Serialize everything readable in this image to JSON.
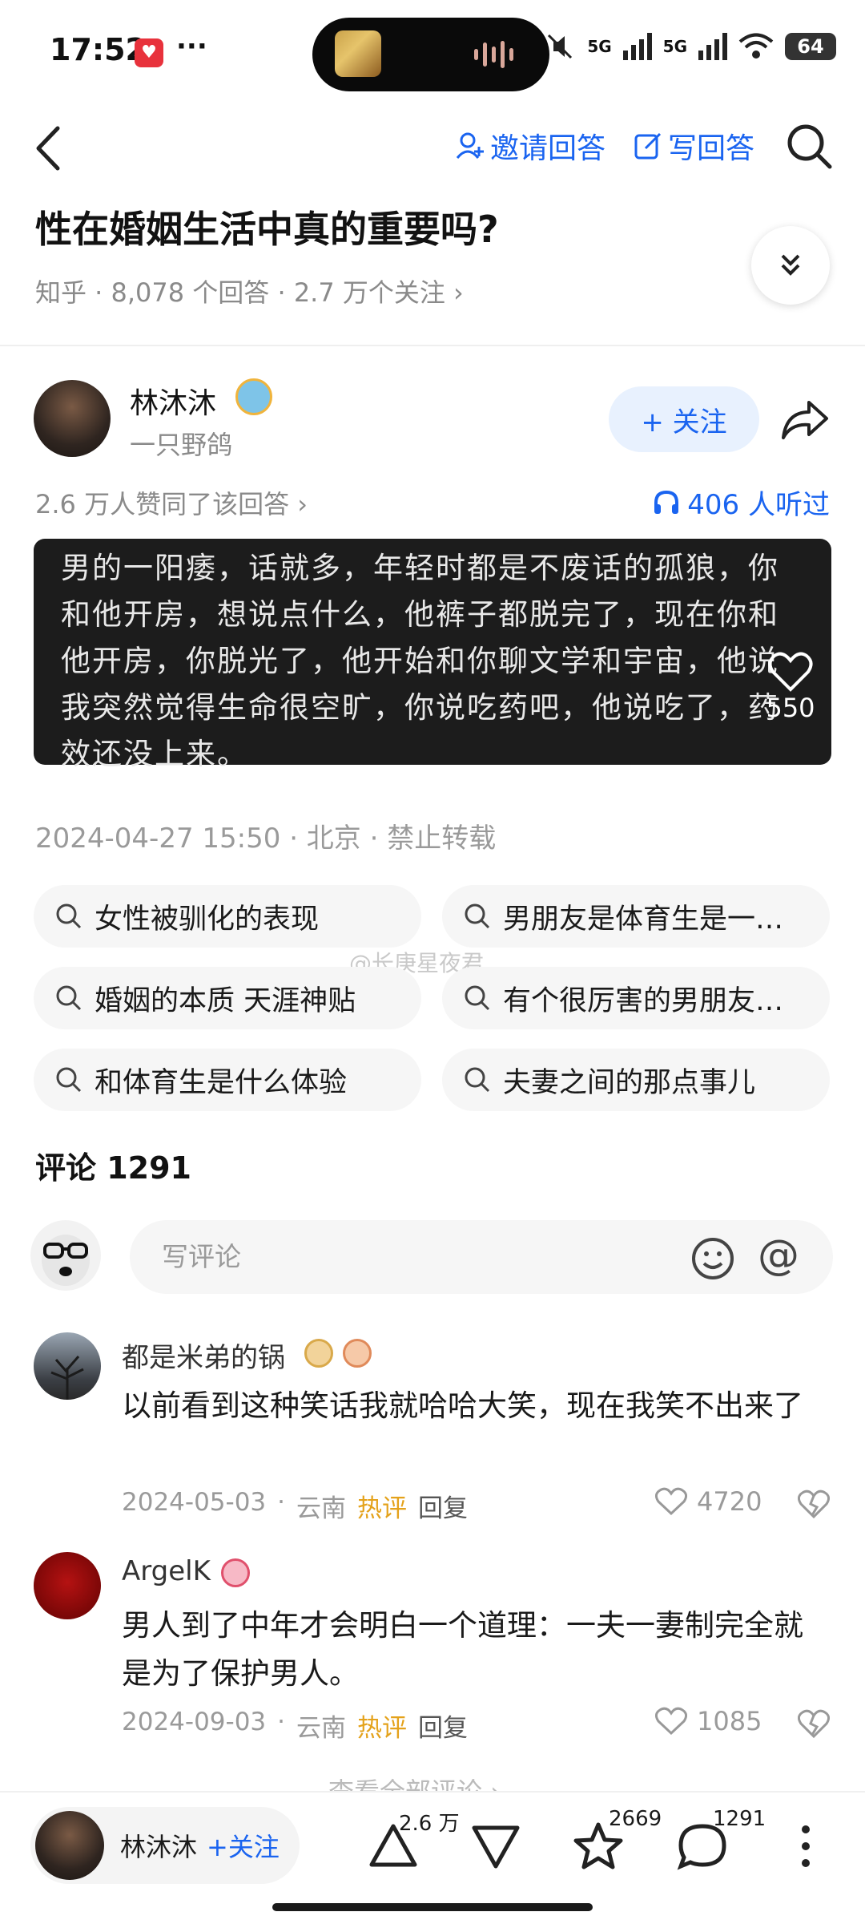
{
  "status_bar": {
    "time": "17:52",
    "dots": "···",
    "battery": "64",
    "net1": "5G",
    "net2": "5G"
  },
  "nav": {
    "invite_label": "邀请回答",
    "write_label": "写回答"
  },
  "question": {
    "title": "性在婚姻生活中真的重要吗?",
    "meta": "知乎 · 8,078 个回答 · 2.7 万个关注 ›"
  },
  "author": {
    "name": "林沐沐",
    "subtitle": "一只野鸽",
    "follow_label": "+ 关注",
    "likes_line": "2.6 万人赞同了该回答 ›",
    "listened": "406 人听过"
  },
  "answer": {
    "text": "男的一阳痿，话就多，年轻时都是不废话的孤狼，你和他开房，想说点什么，他裤子都脱完了，现在你和他开房，你脱光了，他开始和你聊文学和宇宙，他说我突然觉得生命很空旷，你说吃药吧，他说吃了，药效还没上来。",
    "heart_count": "550",
    "meta": "2024-04-27 15:50 · 北京 · 禁止转载"
  },
  "related_chips": [
    "女性被驯化的表现",
    "男朋友是体育生是一…",
    "婚姻的本质 天涯神贴",
    "有个很厉害的男朋友…",
    "和体育生是什么体验",
    "夫妻之间的那点事儿"
  ],
  "watermark": "@长庚星夜君",
  "comments_section": {
    "title": "评论 1291",
    "input_placeholder": "写评论",
    "at_symbol": "@",
    "view_all": "查看全部评论 ›"
  },
  "comments": [
    {
      "name": "都是米弟的锅",
      "text": "以前看到这种笑话我就哈哈大笑，现在我笑不出来了",
      "date": "2024-05-03",
      "location": "云南",
      "hot": "热评",
      "reply": "回复",
      "likes": "4720"
    },
    {
      "name": "ArgelK",
      "text": "男人到了中年才会明白一个道理：一夫一妻制完全就是为了保护男人。",
      "date": "2024-09-03",
      "location": "云南",
      "hot": "热评",
      "reply": "回复",
      "likes": "1085"
    }
  ],
  "bottom_bar": {
    "author_name": "林沐沐",
    "follow_label": "+关注",
    "upvote_count": "2.6 万",
    "favorite_count": "2669",
    "comment_count": "1291"
  },
  "colors": {
    "accent": "#1a64f0",
    "hot": "#e4a21b",
    "muted": "#8a8a8a"
  }
}
